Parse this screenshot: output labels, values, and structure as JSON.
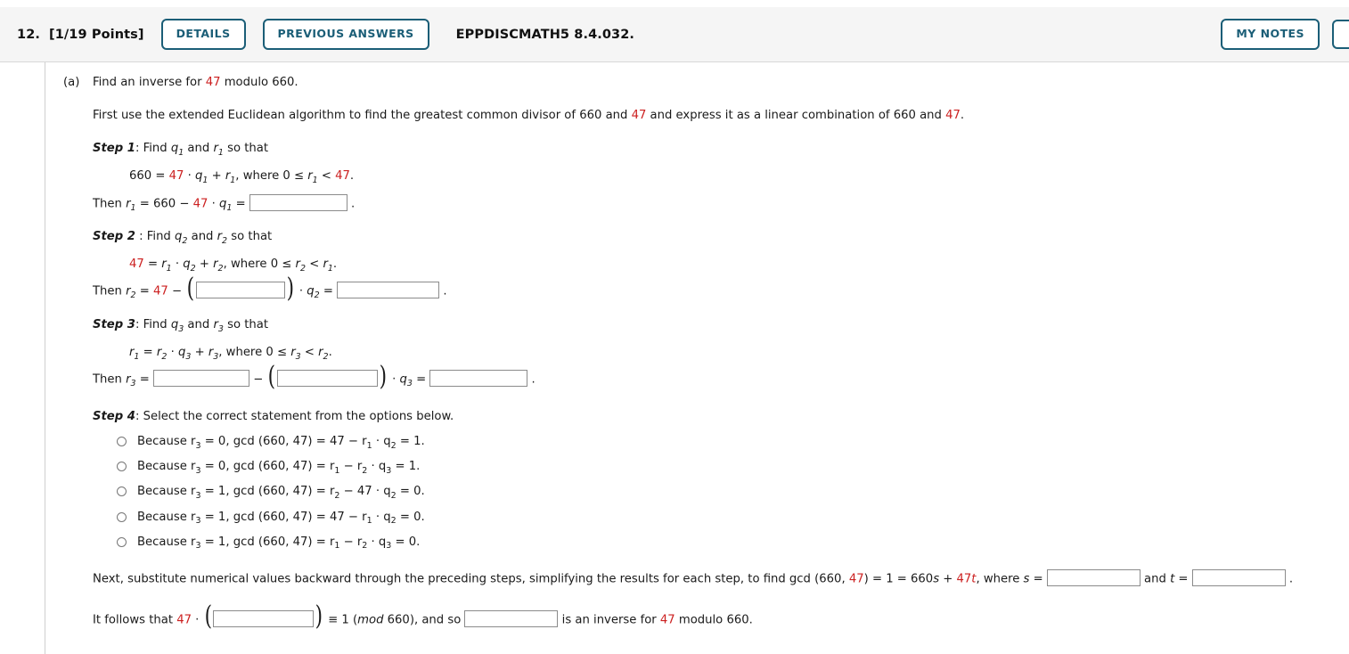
{
  "header": {
    "number": "12.",
    "points": "[1/19 Points]",
    "details_label": "DETAILS",
    "previous_answers_label": "PREVIOUS ANSWERS",
    "textbook_code": "EPPDISCMATH5 8.4.032.",
    "my_notes_label": "MY NOTES",
    "accent_color": "#1b5e77",
    "bar_color": "#f5f5f5"
  },
  "problem": {
    "part_label": "(a)",
    "prompt_pre": "Find an inverse for ",
    "prompt_num": "47",
    "prompt_post": " modulo 660.",
    "intro_a": "First use the extended Euclidean algorithm to find the greatest common divisor of 660 and ",
    "intro_num1": "47",
    "intro_b": " and express it as a linear combination of 660 and ",
    "intro_num2": "47",
    "intro_c": ".",
    "highlight_color": "#cc2020"
  },
  "step1": {
    "title": "Step 1",
    "title_sep": ": ",
    "find_pre": "Find ",
    "var_q": "q",
    "sub_1": "1",
    "find_mid": " and ",
    "var_r": "r",
    "find_post": " so that",
    "eq_660": "660",
    "eq_eq": " = ",
    "eq_47": "47",
    "eq_dot": " · ",
    "eq_plus": " + ",
    "eq_comma": ",",
    "where": "  where  ",
    "zero": "0 ",
    "le": "≤ ",
    "lt": " < ",
    "bound": "47",
    "period": ".",
    "then_pre": "Then ",
    "then_eq": " = 660 − ",
    "then_47": "47",
    "then_dot": " · ",
    "then_eqs": " = ",
    "answer": ""
  },
  "step2": {
    "title": "Step 2",
    "title_sep": " : ",
    "find_pre": "Find ",
    "sub_2": "2",
    "find_mid": " and ",
    "find_post": " so that",
    "eq_47": "47",
    "where": "  where  ",
    "then_pre": "Then ",
    "then_47": "47",
    "answer1": "",
    "answer2": ""
  },
  "step3": {
    "title": "Step 3",
    "title_sep": ": ",
    "find_pre": "Find ",
    "sub_3": "3",
    "find_mid": " and ",
    "find_post": " so that",
    "where": "  where  ",
    "then_pre": "Then ",
    "answer1": "",
    "answer2": "",
    "answer3": ""
  },
  "step4": {
    "title": "Step 4",
    "title_sep": ": ",
    "instruction": "Select the correct statement from the options below.",
    "options": [
      {
        "pre": "Because r",
        "sub1": "3",
        "mid1": " = 0, gcd (660, 47) = 47 − r",
        "sub2": "1",
        "mid2": " · q",
        "sub3": "2",
        "post": " = 1."
      },
      {
        "pre": "Because r",
        "sub1": "3",
        "mid1": " = 0, gcd (660, 47) = r",
        "sub2": "1",
        "mid2": " − r",
        "sub3": "2",
        "mid3": " · q",
        "sub4": "3",
        "post": " = 1."
      },
      {
        "pre": "Because r",
        "sub1": "3",
        "mid1": " = 1, gcd (660, 47) = r",
        "sub2": "2",
        "mid2": " − 47 · q",
        "sub3": "2",
        "post": " = 0."
      },
      {
        "pre": "Because r",
        "sub1": "3",
        "mid1": " = 1, gcd (660, 47) = 47 − r",
        "sub2": "1",
        "mid2": " · q",
        "sub3": "2",
        "post": " = 0."
      },
      {
        "pre": "Because r",
        "sub1": "3",
        "mid1": " = 1, gcd (660, 47) = r",
        "sub2": "1",
        "mid2": " − r",
        "sub3": "2",
        "mid3": " · q",
        "sub4": "3",
        "post": " = 0."
      }
    ]
  },
  "final": {
    "next_a": "Next, substitute numerical values backward through the preceding steps, simplifying the results for each step, to find gcd (660, ",
    "next_47": "47",
    "next_b": ") = 1 = 660",
    "next_s": "s",
    "next_c": " + ",
    "next_47b": "47",
    "next_t": "t",
    "next_d": ",  where  ",
    "s_label": "s",
    "eq": " = ",
    "and_label": "and ",
    "t_label": "t",
    "period": ".",
    "s_value": "",
    "t_value": "",
    "follows_pre": "It follows that ",
    "follows_47": "47",
    "follows_dot": " · ",
    "follows_mid": " ≡ 1 (",
    "mod_ital": "mod",
    "follows_mid2": " 660), and so ",
    "follows_post": " is an inverse for ",
    "follows_47b": "47",
    "follows_end": " modulo 660.",
    "paren_value": "",
    "inverse_value": ""
  }
}
